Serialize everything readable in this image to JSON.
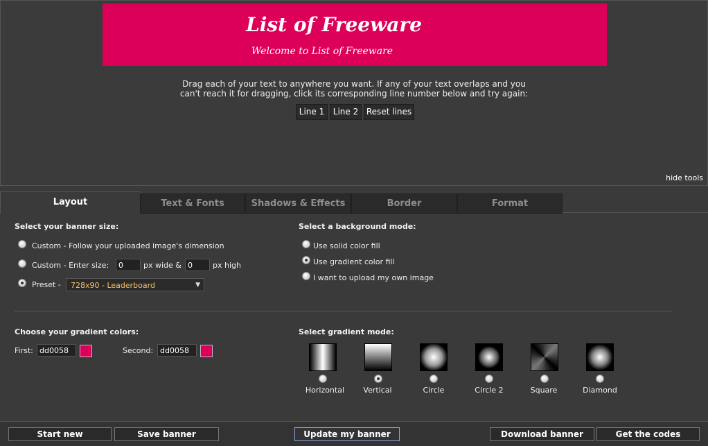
{
  "banner": {
    "line1": "List of Freeware",
    "line2": "Welcome to List of Freeware",
    "bg_color": "#dd0058"
  },
  "instructions": "Drag each of your text to anywhere you want. If any of your text overlaps and you can't reach it for dragging, click its corresponding line number below and try again:",
  "line_buttons": {
    "line1": "Line 1",
    "line2": "Line 2",
    "reset": "Reset lines"
  },
  "hide_tools": "hide tools",
  "tabs": [
    {
      "label": "Layout",
      "active": true
    },
    {
      "label": "Text & Fonts"
    },
    {
      "label": "Shadows & Effects"
    },
    {
      "label": "Border"
    },
    {
      "label": "Format"
    }
  ],
  "size": {
    "heading": "Select your banner size:",
    "custom_follow": "Custom - Follow your uploaded image's dimension",
    "custom_enter": "Custom - Enter size:",
    "width_value": "0",
    "px_wide": "px wide &",
    "height_value": "0",
    "px_high": "px high",
    "preset_label": "Preset -",
    "preset_value": "728x90 - Leaderboard",
    "selected": "preset"
  },
  "background": {
    "heading": "Select a background mode:",
    "solid": "Use solid color fill",
    "gradient": "Use gradient color fill",
    "upload": "I want to upload my own image",
    "selected": "gradient"
  },
  "gradient_colors": {
    "heading": "Choose your gradient colors:",
    "first_label": "First:",
    "first_value": "dd0058",
    "second_label": "Second:",
    "second_value": "dd0058",
    "swatch_color": "#dd0058"
  },
  "gradient_mode": {
    "heading": "Select gradient mode:",
    "modes": [
      "Horizontal",
      "Vertical",
      "Circle",
      "Circle 2",
      "Square",
      "Diamond"
    ],
    "selected": "Vertical"
  },
  "footer": {
    "start_new": "Start new",
    "save": "Save banner",
    "update": "Update my banner",
    "download": "Download banner",
    "codes": "Get the codes"
  }
}
